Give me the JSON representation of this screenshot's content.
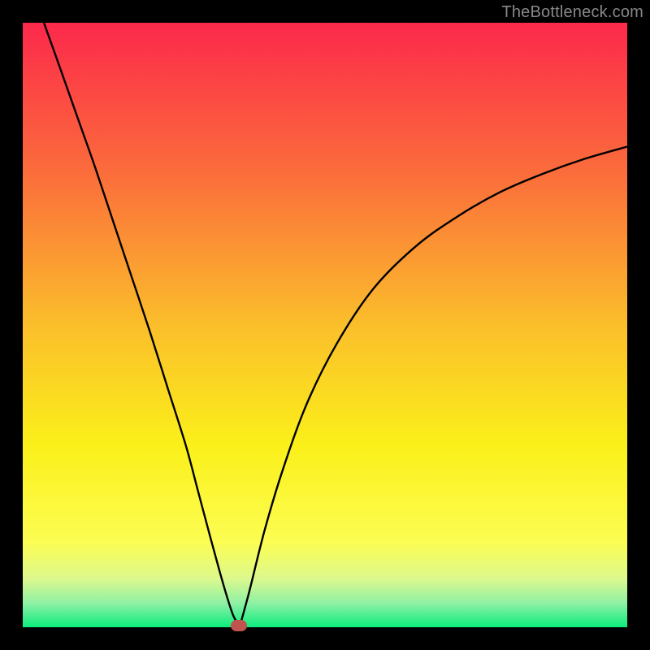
{
  "watermark": "TheBottleneck.com",
  "chart_data": {
    "type": "line",
    "title": "",
    "xlabel": "",
    "ylabel": "",
    "xlim": [
      0,
      1
    ],
    "ylim": [
      0,
      1
    ],
    "grid": false,
    "legend": false,
    "background_gradient": {
      "stops": [
        {
          "offset": 0.0,
          "color": "#fc294b"
        },
        {
          "offset": 0.25,
          "color": "#fb6d3b"
        },
        {
          "offset": 0.5,
          "color": "#fbbe2b"
        },
        {
          "offset": 0.7,
          "color": "#fbf01a"
        },
        {
          "offset": 0.86,
          "color": "#fcfd53"
        },
        {
          "offset": 0.92,
          "color": "#dcf98e"
        },
        {
          "offset": 0.96,
          "color": "#8ff0a4"
        },
        {
          "offset": 1.0,
          "color": "#0bed7e"
        }
      ]
    },
    "series": [
      {
        "name": "left-branch",
        "color": "#000000",
        "x": [
          0.035,
          0.06,
          0.09,
          0.12,
          0.15,
          0.18,
          0.21,
          0.24,
          0.27,
          0.29,
          0.31,
          0.325,
          0.338,
          0.348,
          0.356
        ],
        "y": [
          1.0,
          0.93,
          0.845,
          0.76,
          0.67,
          0.58,
          0.49,
          0.395,
          0.3,
          0.225,
          0.15,
          0.095,
          0.05,
          0.02,
          0.005
        ]
      },
      {
        "name": "right-branch",
        "color": "#000000",
        "x": [
          0.36,
          0.375,
          0.4,
          0.43,
          0.47,
          0.52,
          0.58,
          0.65,
          0.72,
          0.79,
          0.86,
          0.93,
          1.0
        ],
        "y": [
          0.005,
          0.06,
          0.16,
          0.26,
          0.37,
          0.47,
          0.56,
          0.63,
          0.68,
          0.72,
          0.75,
          0.775,
          0.795
        ]
      }
    ],
    "marker": {
      "x": 0.358,
      "y": 0.003,
      "color": "#c1544e"
    }
  }
}
